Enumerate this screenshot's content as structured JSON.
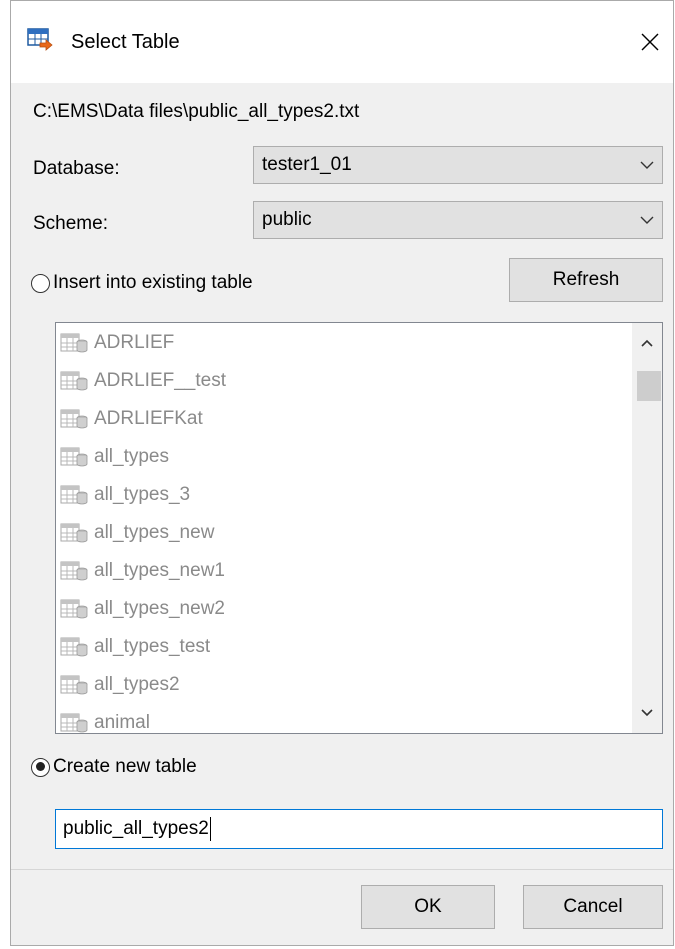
{
  "window": {
    "title": "Select Table"
  },
  "file_path": "C:\\EMS\\Data files\\public_all_types2.txt",
  "database": {
    "label": "Database:",
    "value": "tester1_01"
  },
  "scheme": {
    "label": "Scheme:",
    "value": "public"
  },
  "insert_option": {
    "label": "Insert into existing table",
    "selected": false
  },
  "refresh_button": "Refresh",
  "tables": [
    "ADRLIEF",
    "ADRLIEF__test",
    "ADRLIEFKat",
    "all_types",
    "all_types_3",
    "all_types_new",
    "all_types_new1",
    "all_types_new2",
    "all_types_test",
    "all_types2",
    "animal"
  ],
  "create_option": {
    "label": "Create new table",
    "selected": true
  },
  "new_table_name": "public_all_types2",
  "ok_button": "OK",
  "cancel_button": "Cancel",
  "icons": {
    "title": "table-import-icon",
    "close": "close-icon",
    "dropdown": "chevron-down-icon",
    "table": "table-icon"
  }
}
